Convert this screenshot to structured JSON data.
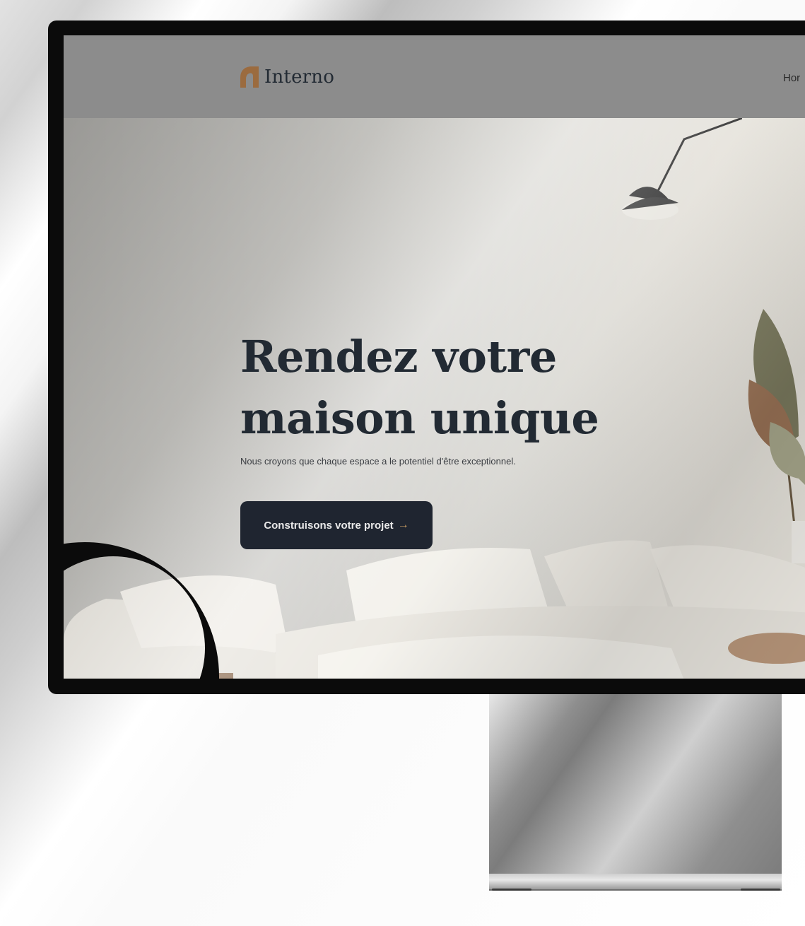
{
  "nav": {
    "logo_text": "Interno",
    "link_home": "Hor"
  },
  "hero": {
    "title_line1": "Rendez votre",
    "title_line2": "maison unique",
    "subtitle": "Nous croyons que chaque espace a le potentiel d'être exceptionnel.",
    "cta_label": "Construisons votre projet",
    "cta_arrow": "→"
  },
  "colors": {
    "brand_dark": "#222a33",
    "accent": "#9b6b3f",
    "cta_bg": "#1f2530",
    "cta_arrow": "#c59a62"
  },
  "icons": {
    "logo": "house-roof-icon",
    "cta": "arrow-right-icon"
  }
}
